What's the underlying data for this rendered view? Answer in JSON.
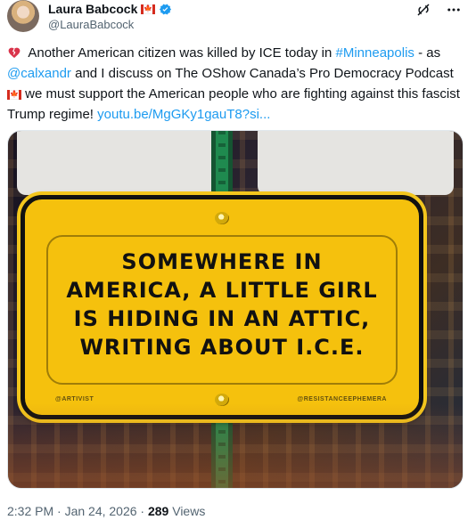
{
  "author": {
    "name": "Laura Babcock",
    "handle": "@LauraBabcock",
    "flag": "🇨🇦"
  },
  "tweet": {
    "emoji_heart": "💔",
    "text_part1": "Another American citizen was killed by ICE today in",
    "hashtag": "#Minneapolis",
    "text_part2": "- as",
    "mention": "@calxandr",
    "text_part3": "and I discuss on The OShow Canada’s Pro Democracy Podcast",
    "flag2": "🇨🇦",
    "text_part4": "we must support the American people who are fighting against this fascist Trump regime!",
    "link": "youtu.be/MgGKy1gauT8?si..."
  },
  "image": {
    "sign_lines": [
      "SOMEWHERE IN",
      "AMERICA, A LITTLE GIRL",
      "IS HIDING IN AN ATTIC,",
      "WRITING ABOUT I.C.E."
    ],
    "credit_left": "@ARTIVIST",
    "credit_right": "@RESISTANCEEPHEMERA"
  },
  "footer": {
    "timestamp": "2:32 PM · Jan 24, 2026 ·",
    "views": "289",
    "views_label": "Views"
  },
  "icons": {
    "grok": "grok-icon",
    "more": "more-icon",
    "verified": "verified-badge-icon"
  },
  "colors": {
    "link": "#1d9bf0",
    "verified": "#1d9bf0",
    "sign_yellow": "#f5c10d"
  }
}
